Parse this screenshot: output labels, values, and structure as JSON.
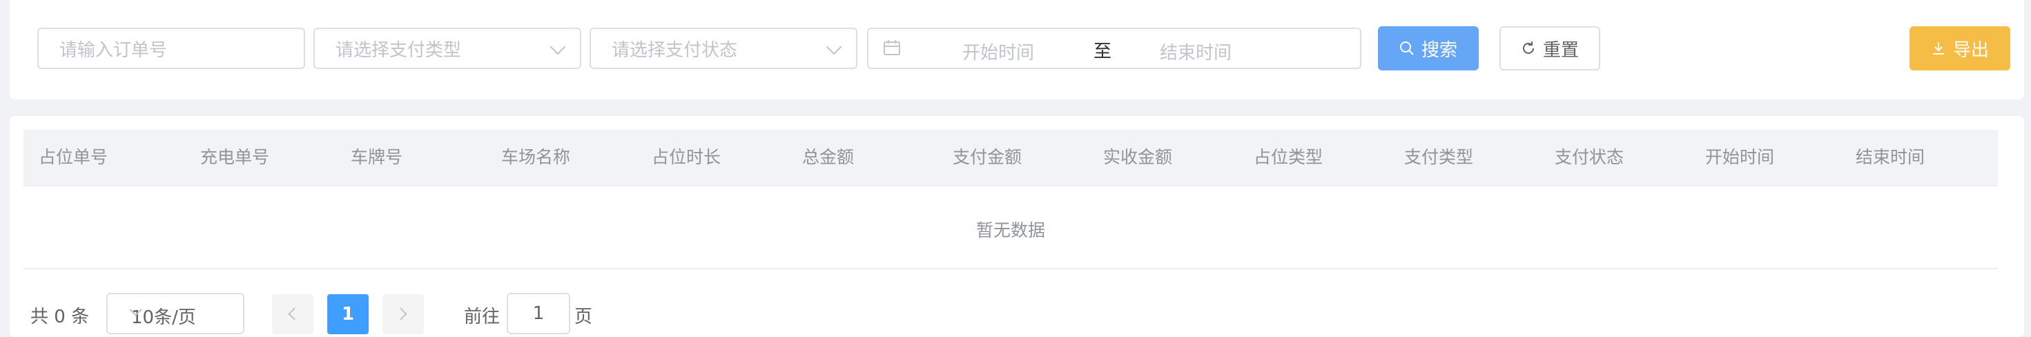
{
  "filters": {
    "order_placeholder": "请输入订单号",
    "pay_type_placeholder": "请选择支付类型",
    "pay_status_placeholder": "请选择支付状态",
    "start_placeholder": "开始时间",
    "range_separator": "至",
    "end_placeholder": "结束时间"
  },
  "buttons": {
    "search": "搜索",
    "reset": "重置",
    "export": "导出"
  },
  "table": {
    "columns": [
      "占位单号",
      "充电单号",
      "车牌号",
      "车场名称",
      "占位时长",
      "总金额",
      "支付金额",
      "实收金额",
      "占位类型",
      "支付类型",
      "支付状态",
      "开始时间",
      "结束时间"
    ],
    "empty_text": "暂无数据"
  },
  "pagination": {
    "total": "共 0 条",
    "page_size": "10条/页",
    "current_page": "1",
    "goto_label": "前往",
    "goto_value": "1",
    "goto_suffix": "页"
  },
  "colors": {
    "primary": "#409eff",
    "search_button": "#66a6f7",
    "export_button": "#f5bd45"
  },
  "icons": {
    "date": "calendar-icon",
    "search": "search-icon",
    "reset": "refresh-icon",
    "export": "download-icon"
  }
}
